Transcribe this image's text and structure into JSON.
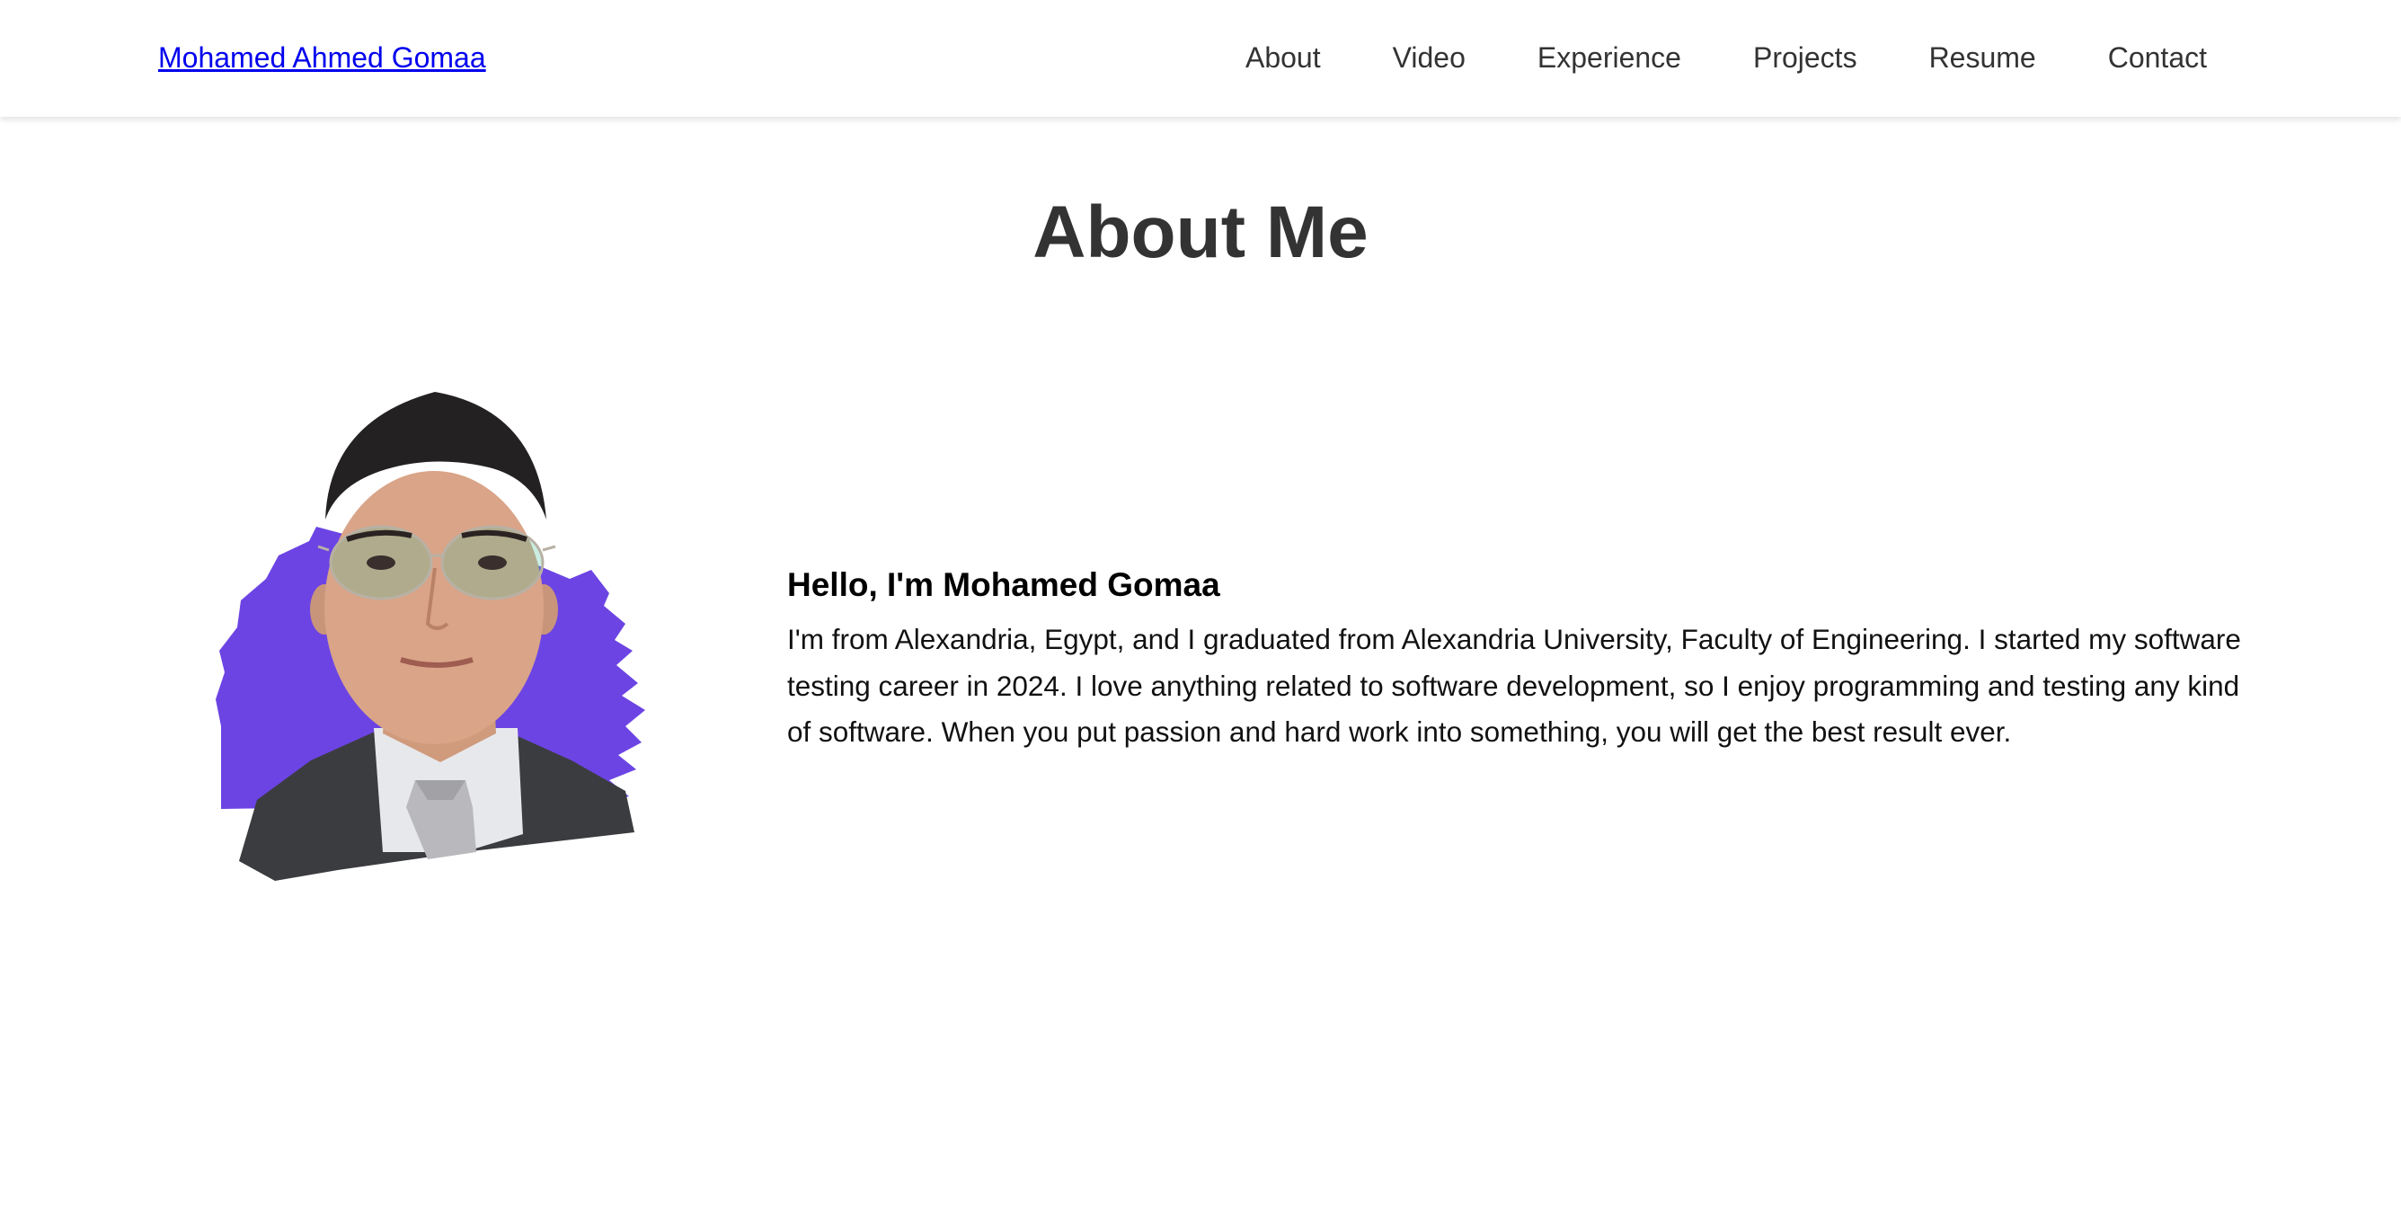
{
  "header": {
    "brand": "Mohamed Ahmed Gomaa",
    "nav": [
      {
        "label": "About"
      },
      {
        "label": "Video"
      },
      {
        "label": "Experience"
      },
      {
        "label": "Projects"
      },
      {
        "label": "Resume"
      },
      {
        "label": "Contact"
      }
    ]
  },
  "about": {
    "title": "About Me",
    "greeting": "Hello, I'm Mohamed Gomaa",
    "bio": "I'm from Alexandria, Egypt, and I graduated from Alexandria University, Faculty of Engineering. I started my software testing career in 2024. I love anything related to software development, so I enjoy programming and testing any kind of software. When you put passion and hard work into something, you will get the best result ever.",
    "photo": {
      "icon": "profile-photo",
      "accent_color": "#6c44e3"
    }
  }
}
